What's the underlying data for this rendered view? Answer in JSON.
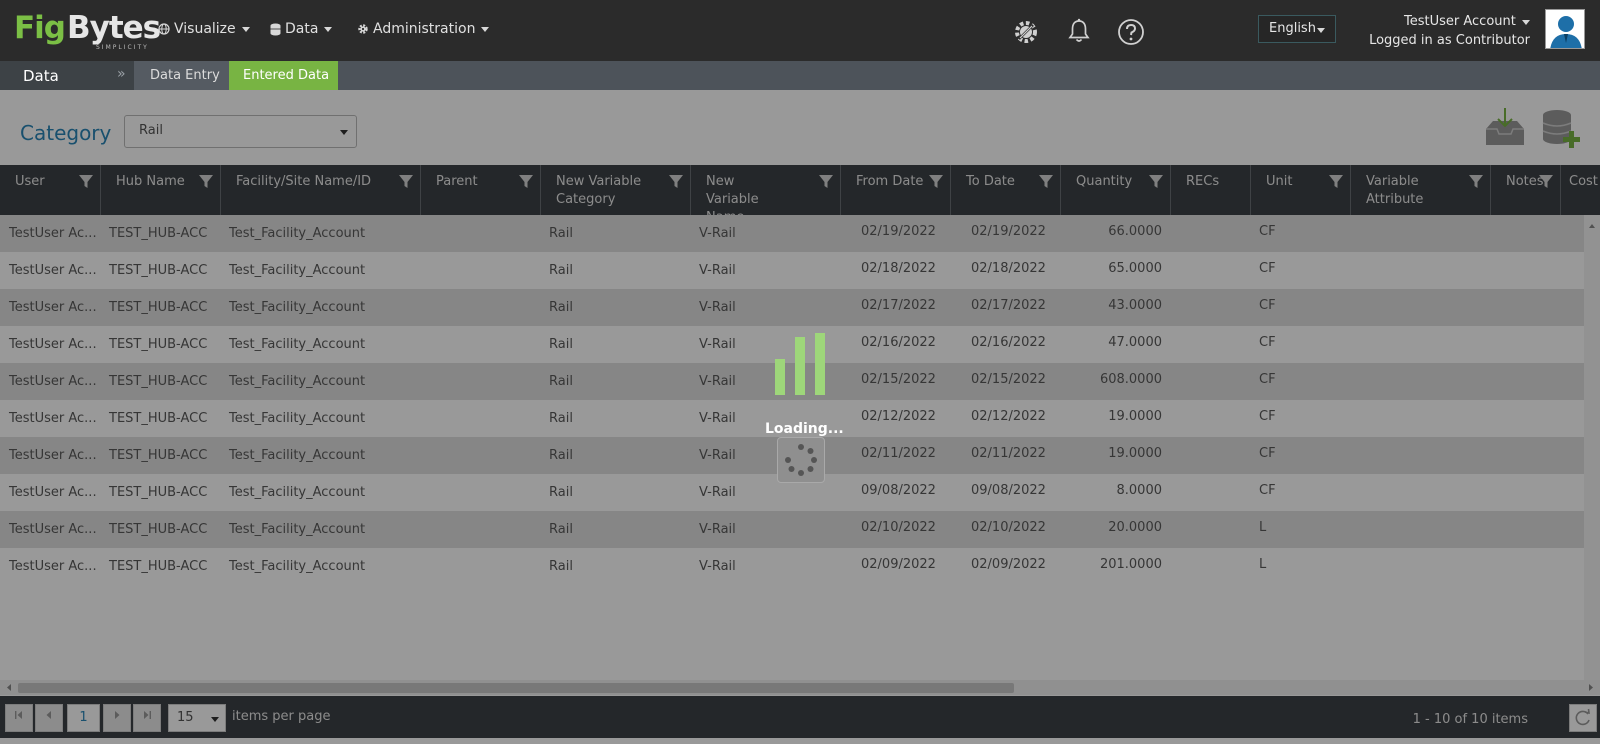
{
  "brand": {
    "part1": "Fig",
    "part2": "Bytes",
    "tagline": "SIMPLICITY",
    "color": "#7bbf45"
  },
  "topnav": [
    {
      "label": "Visualize",
      "icon": "globe-icon"
    },
    {
      "label": "Data",
      "icon": "database-icon"
    },
    {
      "label": "Administration",
      "icon": "gear-icon"
    }
  ],
  "header_icons": [
    "tools-gear-icon",
    "bell-icon",
    "help-icon"
  ],
  "language": "English",
  "account": {
    "name": "TestUser Account",
    "role": "Logged in as Contributor"
  },
  "subnav": {
    "section": "Data",
    "tabs": [
      "Data Entry",
      "Entered Data"
    ],
    "active_tab": "Entered Data",
    "chevron": "»"
  },
  "filter": {
    "label": "Category",
    "selected": "Rail"
  },
  "actions": [
    "download-inbox-icon",
    "add-database-icon"
  ],
  "columns": [
    "User",
    "Hub Name",
    "Facility/Site Name/ID",
    "Parent",
    "New Variable Category",
    "New Variable Name",
    "From Date",
    "To Date",
    "Quantity",
    "RECs",
    "Unit",
    "Variable Attribute",
    "Notes",
    "Cost"
  ],
  "rows": [
    [
      "TestUser Ac...",
      "TEST_HUB-ACC",
      "Test_Facility_Account",
      "",
      "Rail",
      "V-Rail",
      "02/19/2022",
      "02/19/2022",
      "66.0000",
      "",
      "CF"
    ],
    [
      "TestUser Ac...",
      "TEST_HUB-ACC",
      "Test_Facility_Account",
      "",
      "Rail",
      "V-Rail",
      "02/18/2022",
      "02/18/2022",
      "65.0000",
      "",
      "CF"
    ],
    [
      "TestUser Ac...",
      "TEST_HUB-ACC",
      "Test_Facility_Account",
      "",
      "Rail",
      "V-Rail",
      "02/17/2022",
      "02/17/2022",
      "43.0000",
      "",
      "CF"
    ],
    [
      "TestUser Ac...",
      "TEST_HUB-ACC",
      "Test_Facility_Account",
      "",
      "Rail",
      "V-Rail",
      "02/16/2022",
      "02/16/2022",
      "47.0000",
      "",
      "CF"
    ],
    [
      "TestUser Ac...",
      "TEST_HUB-ACC",
      "Test_Facility_Account",
      "",
      "Rail",
      "V-Rail",
      "02/15/2022",
      "02/15/2022",
      "608.0000",
      "",
      "CF"
    ],
    [
      "TestUser Ac...",
      "TEST_HUB-ACC",
      "Test_Facility_Account",
      "",
      "Rail",
      "V-Rail",
      "02/12/2022",
      "02/12/2022",
      "19.0000",
      "",
      "CF"
    ],
    [
      "TestUser Ac...",
      "TEST_HUB-ACC",
      "Test_Facility_Account",
      "",
      "Rail",
      "V-Rail",
      "02/11/2022",
      "02/11/2022",
      "19.0000",
      "",
      "CF"
    ],
    [
      "TestUser Ac...",
      "TEST_HUB-ACC",
      "Test_Facility_Account",
      "",
      "Rail",
      "V-Rail",
      "09/08/2022",
      "09/08/2022",
      "8.0000",
      "",
      "CF"
    ],
    [
      "TestUser Ac...",
      "TEST_HUB-ACC",
      "Test_Facility_Account",
      "",
      "Rail",
      "V-Rail",
      "02/10/2022",
      "02/10/2022",
      "20.0000",
      "",
      "L"
    ],
    [
      "TestUser Ac...",
      "TEST_HUB-ACC",
      "Test_Facility_Account",
      "",
      "Rail",
      "V-Rail",
      "02/09/2022",
      "02/09/2022",
      "201.0000",
      "",
      "L"
    ]
  ],
  "pager": {
    "current_page": "1",
    "page_size": "15",
    "per_page_label": "items per page",
    "info": "1 - 10 of 10 items"
  },
  "loading_text": "Loading..."
}
